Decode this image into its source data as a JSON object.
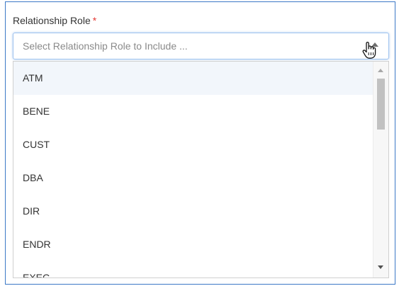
{
  "field": {
    "label": "Relationship Role",
    "required_mark": "*",
    "placeholder": "Select Relationship Role to Include ..."
  },
  "icons": {
    "caret": "caret-up-icon",
    "cursor": "hand-pointer-icon"
  },
  "colors": {
    "frame_border": "#3b78c6",
    "focus_border": "#9fc3ef",
    "required": "#e53935",
    "hover_row": "#f2f6fb"
  },
  "dropdown": {
    "hovered_index": 0,
    "options": [
      {
        "label": "ATM"
      },
      {
        "label": "BENE"
      },
      {
        "label": "CUST"
      },
      {
        "label": "DBA"
      },
      {
        "label": "DIR"
      },
      {
        "label": "ENDR"
      },
      {
        "label": "EXEC"
      }
    ]
  }
}
